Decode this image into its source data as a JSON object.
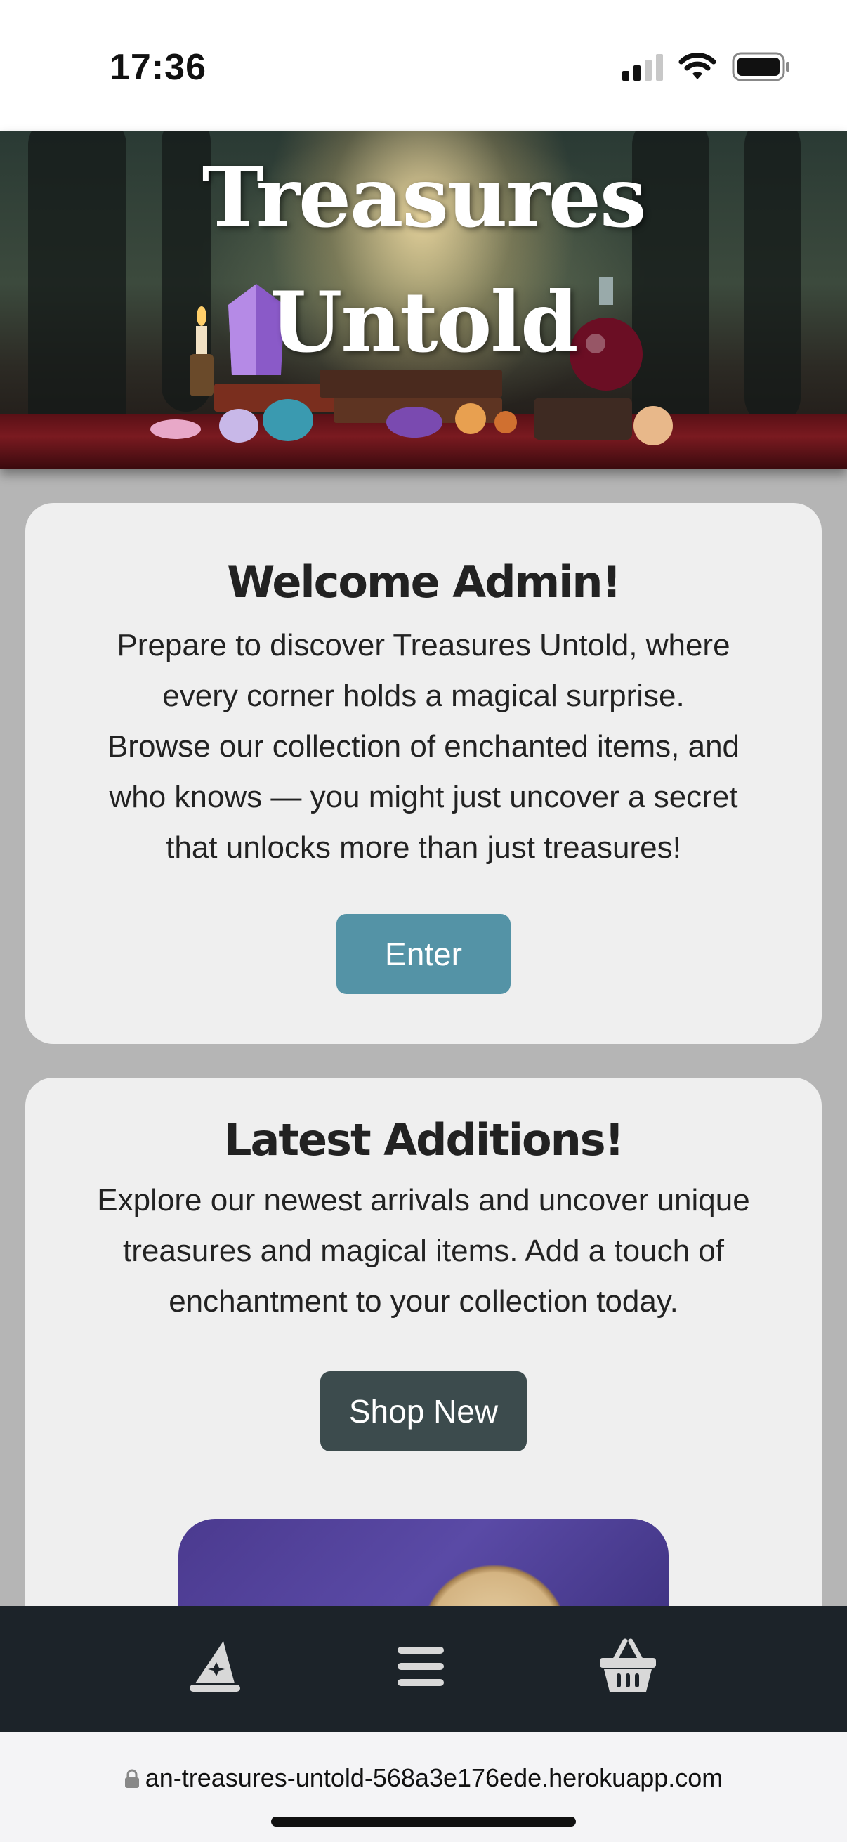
{
  "status_bar": {
    "time": "17:36"
  },
  "hero": {
    "title_line1": "Treasures",
    "title_line2": "Untold"
  },
  "welcome": {
    "heading": "Welcome Admin!",
    "lines": [
      "Prepare to discover Treasures Untold, where",
      "every corner holds a magical surprise.",
      "Browse our collection of enchanted items, and",
      "who knows — you might just uncover a secret",
      "that unlocks more than just treasures!"
    ],
    "button_label": "Enter",
    "button_color": "#5493a6"
  },
  "latest": {
    "heading": "Latest Additions!",
    "lines": [
      "Explore our newest arrivals and uncover unique",
      "treasures and magical items. Add a touch of",
      "enchantment to your collection today."
    ],
    "button_label": "Shop New",
    "button_color": "#3c4b4d"
  },
  "bottom_nav": {
    "items": [
      "wizard-hat-icon",
      "menu-icon",
      "basket-icon"
    ]
  },
  "url_bar": {
    "url": "an-treasures-untold-568a3e176ede.herokuapp.com"
  }
}
